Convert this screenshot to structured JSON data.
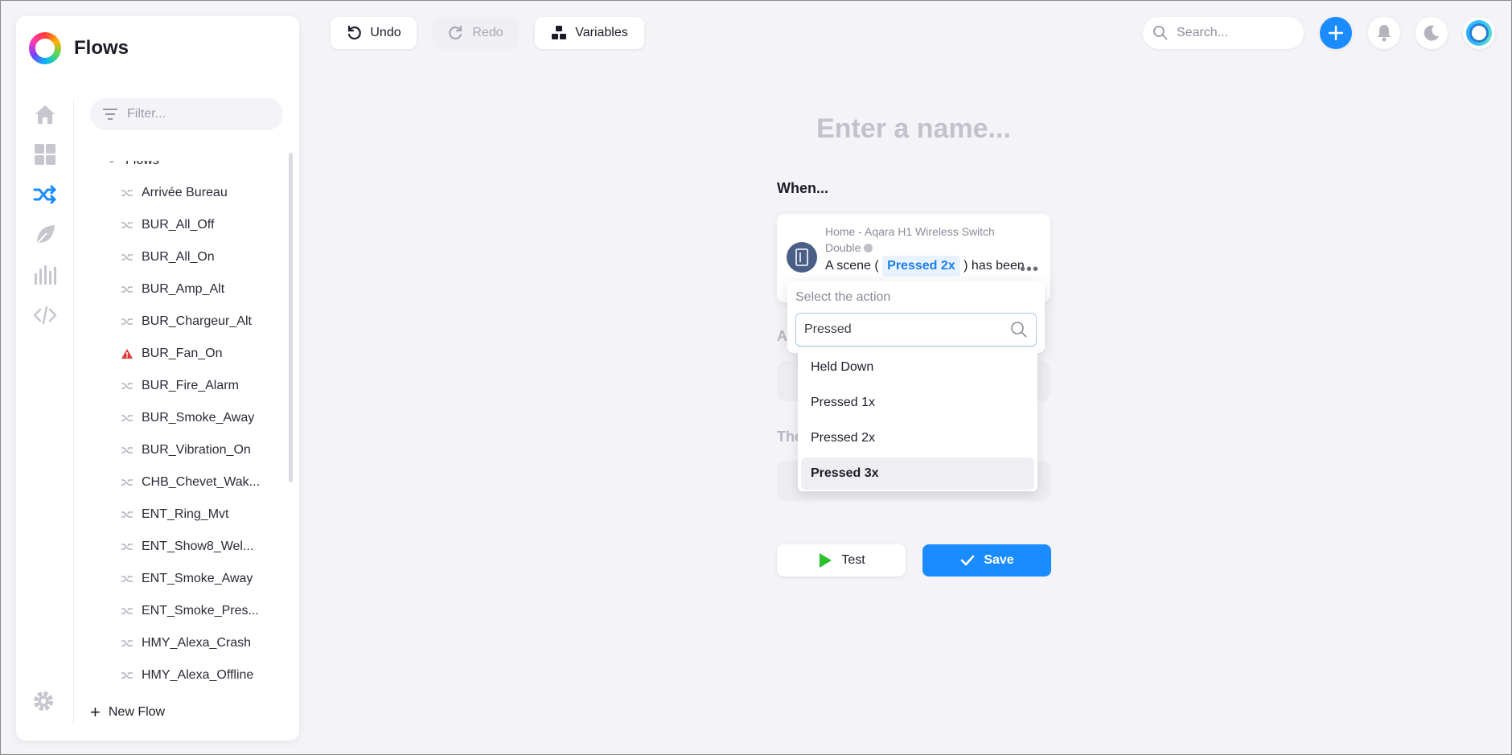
{
  "app": {
    "title": "Flows"
  },
  "sidebar": {
    "filter_placeholder": "Filter...",
    "tree_root": "Flows",
    "flows": [
      {
        "label": "Arrivée Bureau",
        "status": "normal"
      },
      {
        "label": "BUR_All_Off",
        "status": "normal"
      },
      {
        "label": "BUR_All_On",
        "status": "normal"
      },
      {
        "label": "BUR_Amp_Alt",
        "status": "normal"
      },
      {
        "label": "BUR_Chargeur_Alt",
        "status": "normal"
      },
      {
        "label": "BUR_Fan_On",
        "status": "warning"
      },
      {
        "label": "BUR_Fire_Alarm",
        "status": "normal"
      },
      {
        "label": "BUR_Smoke_Away",
        "status": "normal"
      },
      {
        "label": "BUR_Vibration_On",
        "status": "normal"
      },
      {
        "label": "CHB_Chevet_Wak...",
        "status": "normal"
      },
      {
        "label": "ENT_Ring_Mvt",
        "status": "normal"
      },
      {
        "label": "ENT_Show8_Wel...",
        "status": "normal"
      },
      {
        "label": "ENT_Smoke_Away",
        "status": "normal"
      },
      {
        "label": "ENT_Smoke_Pres...",
        "status": "normal"
      },
      {
        "label": "HMY_Alexa_Crash",
        "status": "normal"
      },
      {
        "label": "HMY_Alexa_Offline",
        "status": "normal"
      }
    ],
    "new_flow_label": "New Flow",
    "rail": [
      {
        "name": "home-icon",
        "active": false
      },
      {
        "name": "dashboard-icon",
        "active": false
      },
      {
        "name": "flows-icon",
        "active": true
      },
      {
        "name": "energy-icon",
        "active": false
      },
      {
        "name": "insights-icon",
        "active": false
      },
      {
        "name": "code-icon",
        "active": false
      }
    ]
  },
  "toolbar": {
    "undo_label": "Undo",
    "redo_label": "Redo",
    "variables_label": "Variables",
    "search_placeholder": "Search..."
  },
  "editor": {
    "name_placeholder": "Enter a name...",
    "when_label": "When...",
    "and_label": "A",
    "then_label": "The",
    "trigger": {
      "source": "Home - Aqara H1 Wireless Switch Double",
      "text_before": "A scene (",
      "chip": "Pressed 2x",
      "text_after": ") has been"
    }
  },
  "dropdown": {
    "title": "Select the action",
    "search_value": "Pressed",
    "options": [
      {
        "label": "Held Down",
        "active": false
      },
      {
        "label": "Pressed 1x",
        "active": false
      },
      {
        "label": "Pressed 2x",
        "active": false
      },
      {
        "label": "Pressed 3x",
        "active": true
      }
    ]
  },
  "actions": {
    "test_label": "Test",
    "save_label": "Save"
  },
  "colors": {
    "accent": "#1a8cff",
    "play": "#2bc02b",
    "warning": "#e03b3b",
    "device": "#4a5f87"
  }
}
